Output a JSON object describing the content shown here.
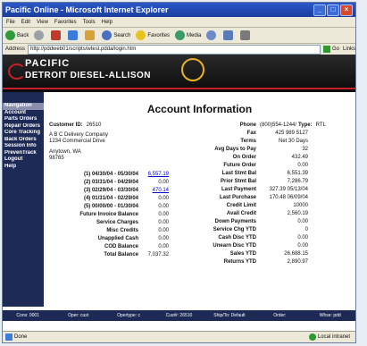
{
  "window": {
    "title": "Pacific Online - Microsoft Internet Explorer"
  },
  "menu": [
    "File",
    "Edit",
    "View",
    "Favorites",
    "Tools",
    "Help"
  ],
  "toolbar": {
    "back": "Back",
    "search": "Search",
    "favorites": "Favorites",
    "media": "Media"
  },
  "address": {
    "label": "Address",
    "url": "http://pddweb01/scripts/wtest.pdda/login.htm",
    "go": "Go",
    "links": "Links"
  },
  "banner": {
    "line1": "PACIFIC",
    "line2": "DETROIT DIESEL-ALLISON"
  },
  "sidebar": {
    "heading": "Navigation",
    "items": [
      "Account",
      "Parts Orders",
      "Repair Orders",
      "Core Tracking",
      "Back Orders",
      "Session Info",
      "PrevenTrack",
      "Logout",
      "Help"
    ]
  },
  "page": {
    "title": "Account Information",
    "customer_label": "Customer ID:",
    "customer_id": "26510",
    "address_lines": [
      "A B C Delivery Company",
      "1234 Commercial Drive",
      "",
      "Anytown, WA",
      "98765"
    ],
    "aging": [
      {
        "label": "(1) 04/30/04 - 05/30/04",
        "value": "6,557.19",
        "link": true
      },
      {
        "label": "(2) 03/31/04 - 04/29/04",
        "value": "0.00",
        "link": false
      },
      {
        "label": "(3) 02/29/04 - 03/30/04",
        "value": "470.14",
        "link": true
      },
      {
        "label": "(4) 01/31/04 - 02/29/04",
        "value": "0.00",
        "link": false
      },
      {
        "label": "(5) 00/00/00 - 01/30/04",
        "value": "0.00",
        "link": false
      }
    ],
    "left_rows": [
      {
        "label": "Future Invoice Balance",
        "value": "0.00"
      },
      {
        "label": "Service Charges",
        "value": "0.00"
      },
      {
        "label": "Misc Credits",
        "value": "0.00"
      },
      {
        "label": "Unapplied Cash",
        "value": "0.00"
      },
      {
        "label": "COD Balance",
        "value": "0.00"
      },
      {
        "label": "Total Balance",
        "value": "7,037.32"
      }
    ],
    "right_top": {
      "phone_label": "Phone",
      "phone": "(800)554-1244/",
      "type_label": "Type:",
      "type": "RTL"
    },
    "right_rows": [
      {
        "label": "Fax",
        "value": "425 989 5127"
      },
      {
        "label": "Terms",
        "value": "Net 30 Days"
      },
      {
        "label": "Avg Days to Pay",
        "value": "32"
      },
      {
        "label": "On Order",
        "value": "432.49"
      },
      {
        "label": "Future Order",
        "value": "0.00"
      },
      {
        "label": "Last Stmt Bal",
        "value": "6,551.39"
      },
      {
        "label": "Prior Stmt Bal",
        "value": "7,286.79"
      },
      {
        "label": "Last Payment",
        "value": "327.39 05/13/04"
      },
      {
        "label": "Last Purchase",
        "value": "170.48 06/09/04"
      },
      {
        "label": "Credit Limit",
        "value": "10000"
      },
      {
        "label": "Avail Credit",
        "value": "2,560.19"
      },
      {
        "label": "Down Payments",
        "value": "0.00"
      },
      {
        "label": "Service Chg YTD",
        "value": "0"
      },
      {
        "label": "Cash Disc YTD",
        "value": "0.00"
      },
      {
        "label": "Unearn Disc YTD",
        "value": "0.00"
      },
      {
        "label": "Sales YTD",
        "value": "26,688.15"
      },
      {
        "label": "Returns YTD",
        "value": "2,890.97"
      }
    ]
  },
  "footer_bar": [
    "Cons: 0001",
    "Oper: cust",
    "Opertype: c",
    "Cust#: 26510",
    "Ship/To: Default",
    "Order:",
    "Whse: pdd"
  ],
  "status": {
    "left": "Done",
    "right": "Local intranet"
  }
}
